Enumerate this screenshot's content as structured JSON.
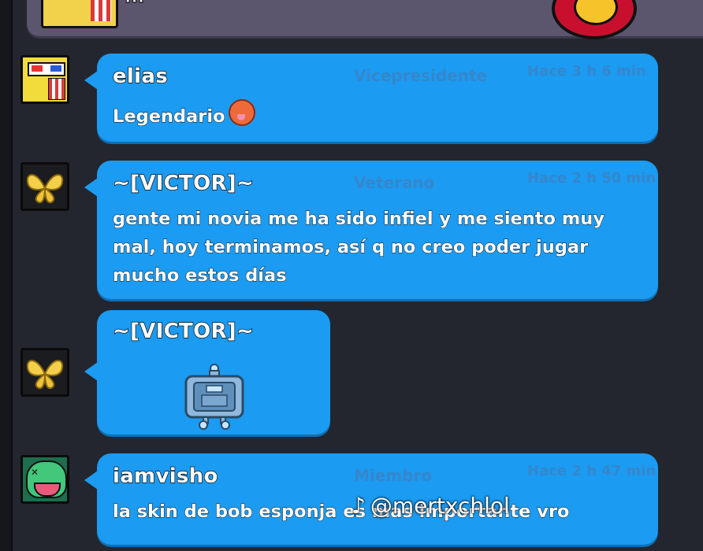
{
  "top_card": {
    "text": "..."
  },
  "messages": [
    {
      "author": "elias",
      "role": "Vicepresidente",
      "time": "Hace 3 h 6 min",
      "text": "Legendario",
      "emoji": "hot-face-emoji",
      "avatar": "spongebob-3d-glasses-icon"
    },
    {
      "author": "~[VICTOR]~",
      "role": "Veterano",
      "time": "Hace 2 h 50 min",
      "lines": [
        "gente mi novia me ha sido infiel y me siento muy",
        "mal, hoy terminamos, así q no creo poder jugar",
        "mucho estos días"
      ],
      "avatar": "golden-butterfly-icon"
    },
    {
      "author": "~[VICTOR]~",
      "sticker": "robot-box-pin-icon",
      "avatar": "golden-butterfly-icon"
    },
    {
      "author": "iamvisho",
      "role": "Miembro",
      "time": "Hace 2 h 47 min",
      "text": "la skin de bob esponja es mas importante vro",
      "avatar": "leon-brawler-icon"
    }
  ],
  "watermark": {
    "handle": "@mertxchlol",
    "icon": "tiktok-icon"
  },
  "colors": {
    "bubble": "#1b9bf2",
    "background": "#23262e",
    "role_text": "#3f7fbf"
  }
}
